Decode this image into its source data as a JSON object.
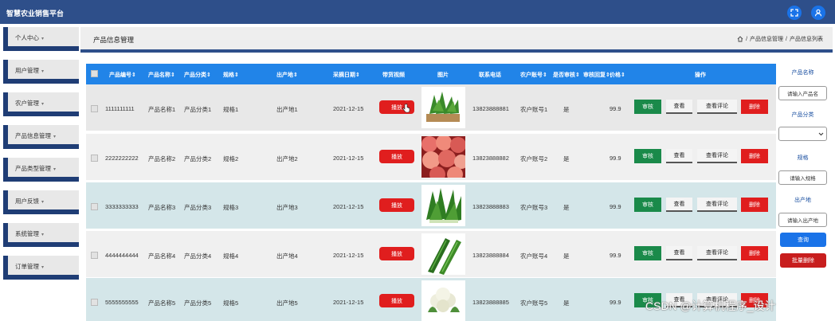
{
  "app": {
    "title": "智慧农业销售平台"
  },
  "sidebar": {
    "items": [
      {
        "label": "个人中心"
      },
      {
        "label": "用户管理"
      },
      {
        "label": "农户管理"
      },
      {
        "label": "产品信息管理"
      },
      {
        "label": "产品类型管理"
      },
      {
        "label": "用户反馈"
      },
      {
        "label": "系统管理"
      },
      {
        "label": "订单管理"
      }
    ]
  },
  "page": {
    "title": "产品信息管理",
    "breadcrumb": [
      "产品信息管理",
      "产品信息列表"
    ]
  },
  "table": {
    "headers": {
      "code": "产品编号",
      "name": "产品名称",
      "category": "产品分类",
      "spec": "规格",
      "origin": "出产地",
      "date": "采摘日期",
      "video": "带货视频",
      "image": "图片",
      "phone": "联系电话",
      "farmer": "农户账号",
      "approved": "是否审核",
      "reply": "审核回复",
      "price": "价格",
      "actions": "操作"
    },
    "rows": [
      {
        "code": "1111111111",
        "name": "产品名称1",
        "category": "产品分类1",
        "spec": "规格1",
        "origin": "出产地1",
        "date": "2021-12-15",
        "play": "播放",
        "image": "spinach-photo",
        "phone": "13823888881",
        "farmer": "农户账号1",
        "approved": "是",
        "price": "99.9"
      },
      {
        "code": "2222222222",
        "name": "产品名称2",
        "category": "产品分类2",
        "spec": "规格2",
        "origin": "出产地2",
        "date": "2021-12-15",
        "play": "播放",
        "image": "peaches-photo",
        "phone": "13823888882",
        "farmer": "农户账号2",
        "approved": "是",
        "price": "99.9"
      },
      {
        "code": "3333333333",
        "name": "产品名称3",
        "category": "产品分类3",
        "spec": "规格3",
        "origin": "出产地3",
        "date": "2021-12-15",
        "play": "播放",
        "image": "greens-photo",
        "phone": "13823888883",
        "farmer": "农户账号3",
        "approved": "是",
        "price": "99.9"
      },
      {
        "code": "4444444444",
        "name": "产品名称4",
        "category": "产品分类4",
        "spec": "规格4",
        "origin": "出产地4",
        "date": "2021-12-15",
        "play": "播放",
        "image": "cucumber-photo",
        "phone": "13823888884",
        "farmer": "农户账号4",
        "approved": "是",
        "price": "99.9"
      },
      {
        "code": "5555555555",
        "name": "产品名称5",
        "category": "产品分类5",
        "spec": "规格5",
        "origin": "出产地5",
        "date": "2021-12-15",
        "play": "播放",
        "image": "cauliflower-photo",
        "phone": "13823888885",
        "farmer": "农户账号5",
        "approved": "是",
        "price": "99.9"
      }
    ],
    "action_labels": {
      "review": "审核",
      "view": "查看",
      "comments": "查看评论",
      "delete": "删除"
    }
  },
  "search": {
    "name_label": "产品名称",
    "name_placeholder": "请输入产品名",
    "category_label": "产品分类",
    "spec_label": "规格",
    "spec_placeholder": "请输入规格",
    "origin_label": "出产地",
    "origin_placeholder": "请输入出产地",
    "search_button": "查询",
    "batch_delete_button": "批量删除"
  },
  "watermark": "CSDN @计算机程序_设计",
  "colors": {
    "topbar": "#2e4f8a",
    "header": "#2184e8",
    "play": "#e01e1e",
    "review": "#1a8a4a",
    "delete": "#e01e1e",
    "query": "#1a73e8"
  }
}
